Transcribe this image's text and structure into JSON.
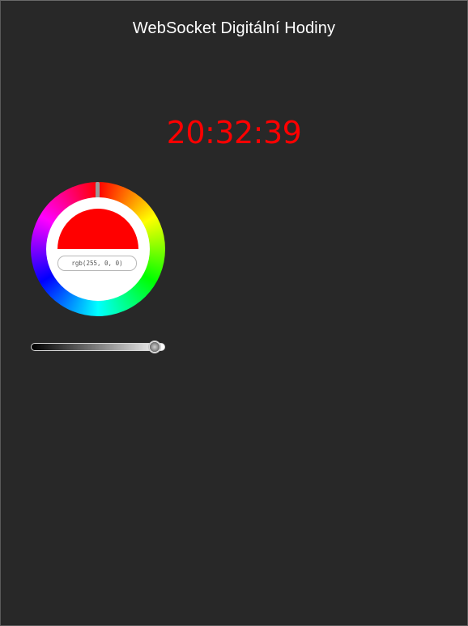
{
  "page": {
    "title": "WebSocket Digitální Hodiny"
  },
  "clock": {
    "time": "20:32:39",
    "color": "#ff0000"
  },
  "color_picker": {
    "readout": "rgb(255, 0, 0)",
    "selected_color": "#ff0000",
    "hue_degrees": 0
  },
  "brightness_slider": {
    "value_fraction": 0.93
  }
}
